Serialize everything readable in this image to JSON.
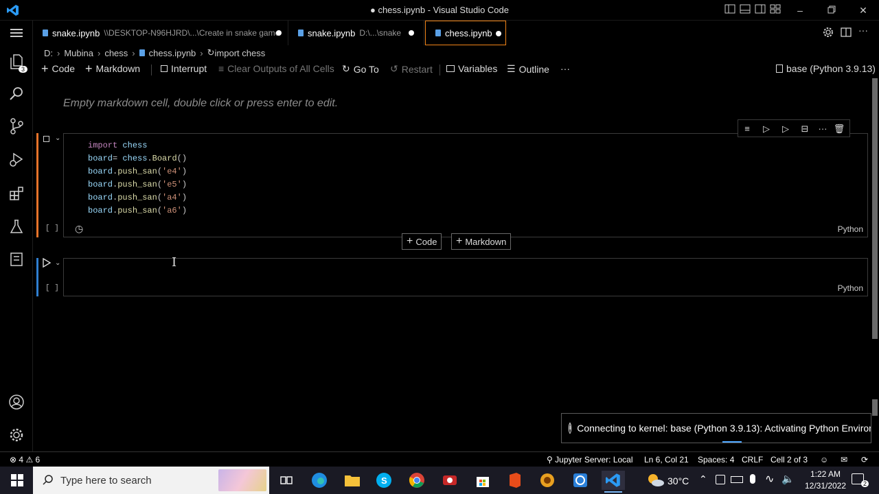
{
  "window": {
    "title": "● chess.ipynb - Visual Studio Code"
  },
  "tabs": [
    {
      "name": "snake.ipynb",
      "path": "\\\\DESKTOP-N96HJRD\\...\\Create in snake game"
    },
    {
      "name": "snake.ipynb",
      "path": "D:\\...\\snake"
    },
    {
      "name": "chess.ipynb",
      "path": ""
    }
  ],
  "breadcrumb": {
    "items": [
      "D:",
      "Mubina",
      "chess",
      "chess.ipynb",
      "import chess"
    ]
  },
  "toolbar": {
    "code": "Code",
    "markdown": "Markdown",
    "interrupt": "Interrupt",
    "clear_outputs": "Clear Outputs of All Cells",
    "goto": "Go To",
    "restart": "Restart",
    "variables": "Variables",
    "outline": "Outline",
    "more": "···",
    "kernel": "base (Python 3.9.13)"
  },
  "activity": {
    "explorer_badge": "3"
  },
  "cells": {
    "markdown_placeholder": "Empty markdown cell, double click or press enter to edit.",
    "code_cell_1": {
      "lines": [
        "import chess",
        "board= chess.Board()",
        "board.push_san('e4')",
        "board.push_san('e5')",
        "board.push_san('a4')",
        "board.push_san('a6')"
      ],
      "exec_count": "[ ]",
      "language": "Python"
    },
    "code_cell_2": {
      "exec_count": "[ ]",
      "language": "Python"
    },
    "add_code": "Code",
    "add_markdown": "Markdown"
  },
  "notification": {
    "text": "Connecting to kernel: base (Python 3.9.13): Activating Python Environ..."
  },
  "statusbar": {
    "errors": "4",
    "warnings": "6",
    "jupyter_server": "Jupyter Server: Local",
    "position": "Ln 6, Col 21",
    "spaces": "Spaces: 4",
    "eol": "CRLF",
    "cell": "Cell 2 of 3"
  },
  "taskbar": {
    "search_placeholder": "Type here to search",
    "temperature": "30°C",
    "time": "1:22 AM",
    "date": "12/31/2022",
    "notification_count": "2"
  },
  "colors": {
    "accent_border": "#f38518",
    "cell_edge": "#e8742a",
    "cell_edge_second": "#2f7fd1"
  }
}
